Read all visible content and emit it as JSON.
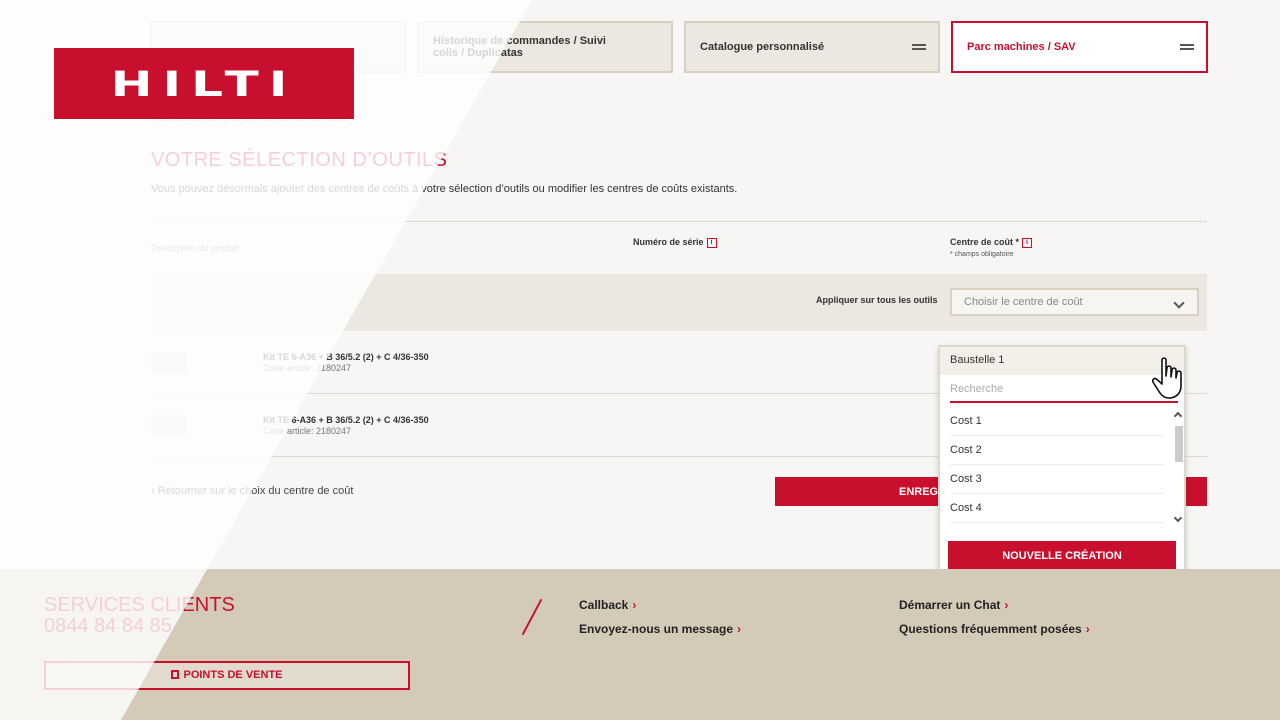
{
  "brand": {
    "logo_text": "HILTI",
    "accent": "#c8102e"
  },
  "topnav": {
    "tabs": [
      {
        "label": "Historique de commandes / Suivi colis / Duplicatas"
      },
      {
        "label": "Catalogue personnalisé"
      },
      {
        "label": "Parc machines / SAV",
        "active": true
      }
    ]
  },
  "main": {
    "top_back_link": "Retourner sur le choix du centre de coût",
    "title": "VOTRE SÉLECTION D’OUTILS",
    "description": "Vous pouvez désormais ajouter des centres de coûts à votre sélection d’outils ou modifier les centres de coûts existants.",
    "columns": {
      "description": "Description du produit",
      "serial": "Numéro de série",
      "cost_center": "Centre de coût *",
      "required_note": "* champs obligatoire",
      "info_glyph": "i"
    },
    "apply_all": {
      "label": "Appliquer sur tous les outils",
      "placeholder": "Choisir le centre de coût"
    },
    "rows": [
      {
        "name": "Kit TE 6-A36 + B 36/5.2 (2) + C 4/36-350",
        "code": "Code article: 2180247"
      },
      {
        "name": "Kit TE 6-A36 + B 36/5.2 (2) + C 4/36-350",
        "code": "Code article: 2180247"
      }
    ],
    "back_link": "Retourner sur le choix du centre de coût",
    "save_label": "ENREGISTRER"
  },
  "dropdown": {
    "selected": "Baustelle 1",
    "search_placeholder": "Recherche",
    "options": [
      "Cost 1",
      "Cost 2",
      "Cost 3",
      "Cost 4"
    ],
    "new_button": "NOUVELLE CRÉATION"
  },
  "footer": {
    "services_title": "SERVICES CLIENTS",
    "phone": "0844 84 84 85",
    "links": {
      "callback": "Callback",
      "message": "Envoyez-nous un message",
      "chat": "Démarrer un Chat",
      "faq": "Questions fréquemment posées",
      "arrow": "›"
    },
    "points_label": "POINTS DE VENTE"
  }
}
